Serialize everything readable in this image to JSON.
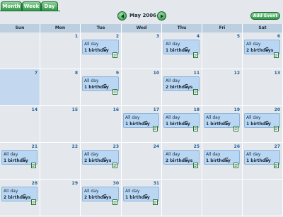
{
  "tabs": [
    {
      "label": "Month"
    },
    {
      "label": "Week"
    },
    {
      "label": "Day"
    }
  ],
  "header": {
    "title": "May 2006",
    "add_event_label": "Add Event",
    "prev_icon": "chevron-left-icon",
    "next_icon": "chevron-right-icon"
  },
  "days_of_week": [
    "Sun",
    "Mon",
    "Tue",
    "Wed",
    "Thu",
    "Fri",
    "Sat"
  ],
  "colors": {
    "tab_green": "#2f9a4a",
    "header_bg": "#bccfe0",
    "cell_bg": "#e4e8ec",
    "today_bg": "#c3d7ef",
    "event_bg": "#b9d6f3",
    "day_number": "#1f5f9a"
  },
  "weeks": [
    [
      {
        "day": ""
      },
      {
        "day": "1"
      },
      {
        "day": "2",
        "event": {
          "allday": "All day",
          "label": "1 birthday"
        }
      },
      {
        "day": "3"
      },
      {
        "day": "4",
        "event": {
          "allday": "All day",
          "label": "1 birthday"
        }
      },
      {
        "day": "5"
      },
      {
        "day": "6",
        "event": {
          "allday": "All day",
          "label": "2 birthdays"
        }
      }
    ],
    [
      {
        "day": "7",
        "today": true
      },
      {
        "day": "8"
      },
      {
        "day": "9",
        "event": {
          "allday": "All day",
          "label": "1 birthday"
        }
      },
      {
        "day": "10"
      },
      {
        "day": "11",
        "event": {
          "allday": "All day",
          "label": "2 birthdays"
        }
      },
      {
        "day": "12"
      },
      {
        "day": "13"
      }
    ],
    [
      {
        "day": "14"
      },
      {
        "day": "15"
      },
      {
        "day": "16"
      },
      {
        "day": "17",
        "event": {
          "allday": "All day",
          "label": "1 birthday"
        }
      },
      {
        "day": "18",
        "event": {
          "allday": "All day",
          "label": "1 birthday"
        }
      },
      {
        "day": "19",
        "event": {
          "allday": "All day",
          "label": "1 birthday"
        }
      },
      {
        "day": "20",
        "event": {
          "allday": "All day",
          "label": "1 birthday"
        }
      }
    ],
    [
      {
        "day": "21",
        "event": {
          "allday": "All day",
          "label": "1 birthday"
        }
      },
      {
        "day": "22"
      },
      {
        "day": "23",
        "event": {
          "allday": "All day",
          "label": "2 birthdays"
        }
      },
      {
        "day": "24"
      },
      {
        "day": "25",
        "event": {
          "allday": "All day",
          "label": "2 birthdays"
        }
      },
      {
        "day": "26",
        "event": {
          "allday": "All day",
          "label": "1 birthday"
        }
      },
      {
        "day": "27",
        "event": {
          "allday": "All day",
          "label": "1 birthday"
        }
      }
    ],
    [
      {
        "day": "28",
        "event": {
          "allday": "All day",
          "label": "2 birthdays"
        }
      },
      {
        "day": "29"
      },
      {
        "day": "30",
        "event": {
          "allday": "All day",
          "label": "2 birthdays"
        }
      },
      {
        "day": "31",
        "event": {
          "allday": "All day",
          "label": "1 birthday"
        }
      },
      {
        "day": ""
      },
      {
        "day": ""
      },
      {
        "day": ""
      }
    ]
  ]
}
